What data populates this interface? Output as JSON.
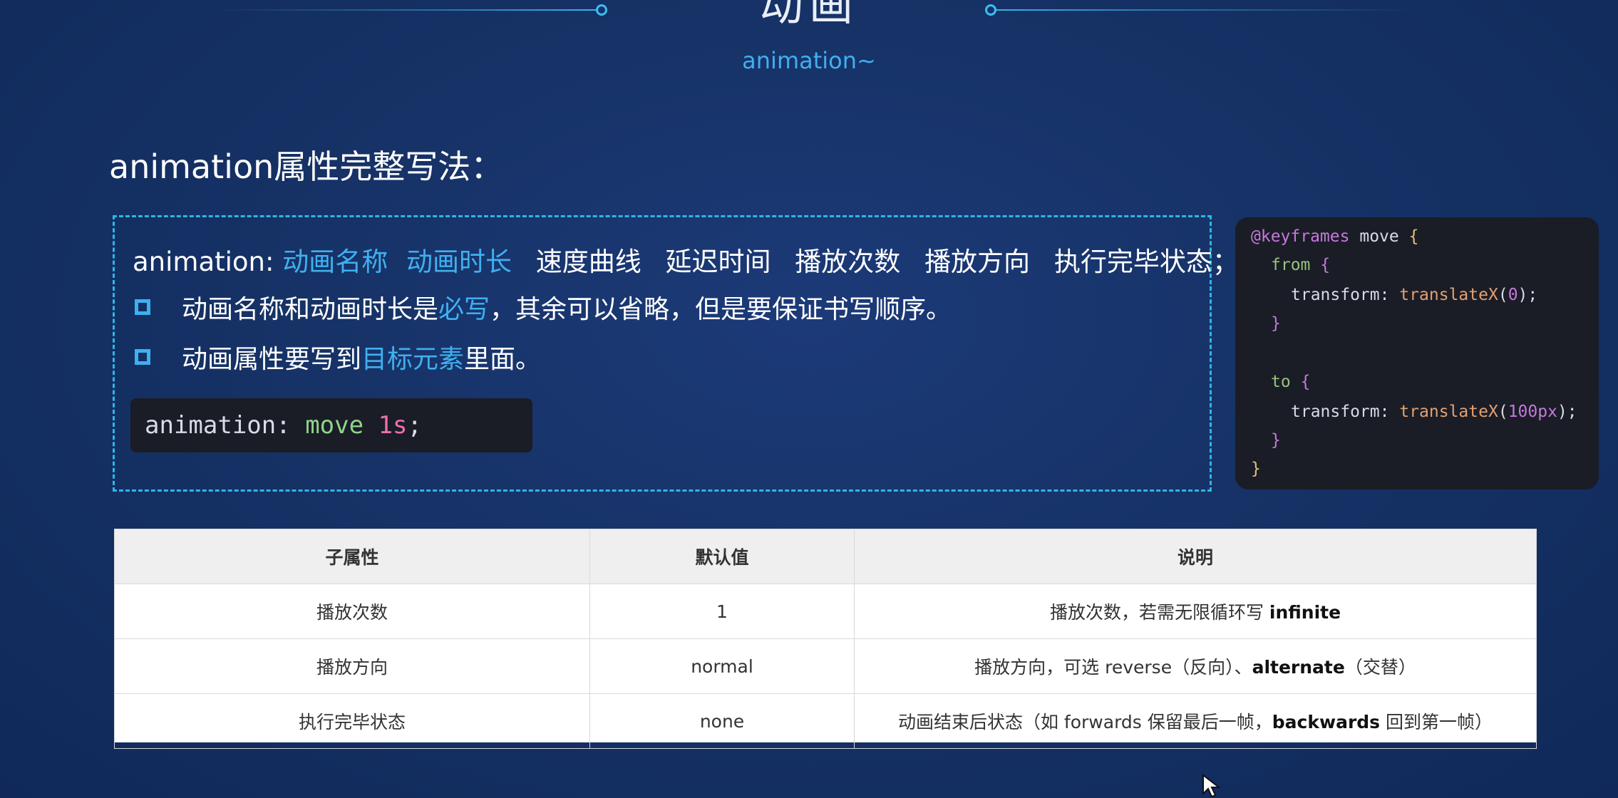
{
  "slide": {
    "title": "动画",
    "subtitle": "animation~",
    "heading": "animation属性完整写法："
  },
  "syntax": {
    "prefix": "animation:",
    "required_1": "动画名称",
    "required_2": "动画时长",
    "optional_1": "速度曲线",
    "optional_2": "延迟时间",
    "optional_3": "播放次数",
    "optional_4": "播放方向",
    "optional_5": "执行完毕状态；"
  },
  "bullets": [
    {
      "pre": "动画名称和动画时长是",
      "accent": "必写",
      "post": "，其余可以省略，但是要保证书写顺序。"
    },
    {
      "pre": "动画属性要写到",
      "accent": "目标元素",
      "post": "里面。"
    }
  ],
  "example_code": {
    "property": "animation:",
    "name": "move",
    "duration": "1s",
    "end": ";"
  },
  "keyframes_code": {
    "at": "@keyframes",
    "name": "move",
    "open": "{",
    "from": "from",
    "to": "to",
    "prop": "transform:",
    "fn": "translateX",
    "from_value": "0",
    "to_value": "100px",
    "close_inner": "}",
    "close_outer": "}"
  },
  "table": {
    "headers": [
      "子属性",
      "默认值",
      "说明"
    ],
    "rows": [
      {
        "prop": "播放次数",
        "default": "1",
        "desc_pre": "播放次数，若需无限循环写 ",
        "desc_bold": "infinite",
        "desc_post": ""
      },
      {
        "prop": "播放方向",
        "default": "normal",
        "desc_pre": "播放方向，可选 reverse（反向）、",
        "desc_bold": "alternate",
        "desc_post": "（交替）"
      },
      {
        "prop": "执行完毕状态",
        "default": "none",
        "desc_pre": "动画结束后状态（如 forwards 保留最后一帧，",
        "desc_bold": "backwards",
        "desc_post": " 回到第一帧）"
      }
    ]
  }
}
